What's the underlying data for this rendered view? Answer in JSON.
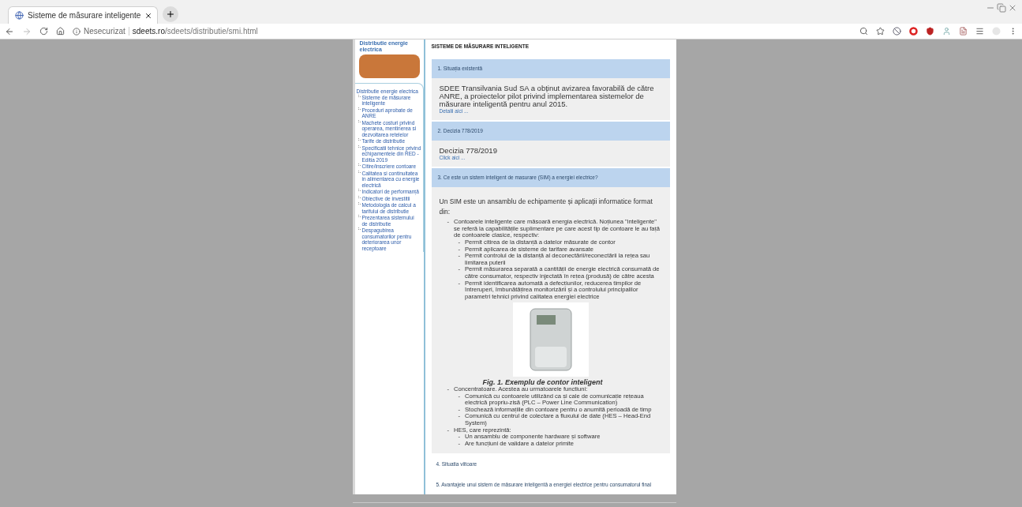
{
  "browser": {
    "tab": {
      "title": "Sisteme de măsurare inteligente",
      "selected": true
    },
    "address": {
      "security": "Nesecurizat",
      "host": "sdeets.ro",
      "path": "/sdeets/distributie/smi.html"
    }
  },
  "sidebar": {
    "header": "Distributie energie electrica",
    "tree": {
      "label": "Distributie energie electrica",
      "children": [
        {
          "label": "Sisteme de măsurare inteligente"
        },
        {
          "label": "Proceduri aprobate de ANRE"
        },
        {
          "label": "Machete costuri privind operarea, mentinerea si dezvoltarea retelelor"
        },
        {
          "label": "Tarife de distributie"
        },
        {
          "label": "Specificatii tehnice privind echipamentele din RED - Editia 2019"
        },
        {
          "label": "Citire/inscriere contoare"
        },
        {
          "label": "Calitatea si continuitatea in alimentarea cu energie electrică"
        },
        {
          "label": "Indicatori de performanță"
        },
        {
          "label": "Obiective de investitii"
        },
        {
          "label": "Metodologia de calcul a tarifului de distributie"
        },
        {
          "label": "Prezentarea sistemului de distributie"
        },
        {
          "label": "Despagubirea consumatorilor pentru deteriorarea unor receptoare"
        }
      ]
    }
  },
  "main": {
    "title": "SISTEME DE MĂSURARE INTELIGENTE",
    "sections": [
      {
        "kind": "band",
        "heading": "1. Situația existentă",
        "body": {
          "text": "SDEE Transilvania Sud SA a obținut avizarea favorabilă de către ANRE, a proiectelor pilot privind implementarea sistemelor de măsurare inteligentă pentru anul 2015.",
          "link": "Detalii aici ..."
        }
      },
      {
        "kind": "band",
        "heading": "2. Decizia 778/2019",
        "body": {
          "text": "Decizia 778/2019",
          "link": "Click aici ..."
        }
      },
      {
        "kind": "band",
        "heading": "3. Ce este un sistem inteligent de masurare (SIM) a energiei electrice?",
        "body": {
          "text": "Un SIM este un ansamblu de echipamente și aplicații informatice format din:",
          "items": [
            {
              "marker": "-",
              "text": "Contoarele inteligente care măsoară energia electrică. Noțiunea \"inteligente\" se referă la capabilitățile suplimentare pe care acest tip de contoare le au față de contoarele clasice, respectiv:",
              "children": [
                {
                  "marker": "-",
                  "text": "Permit citirea de la distanță a datelor măsurate de contor"
                },
                {
                  "marker": "-",
                  "text": "Permit aplicarea de sisteme de tarifare avansate"
                },
                {
                  "marker": "-",
                  "text": "Permit controlul de la distanță al deconectării/reconectării la rețea sau limitarea puterii"
                },
                {
                  "marker": "-",
                  "text": "Permit măsurarea separată a cantității de energie electrică consumată de către consumator, respectiv injectată în rețea (produsă) de către acesta"
                },
                {
                  "marker": "-",
                  "text": "Permit identificarea automată a defecțiunilor, reducerea timpilor de întreruperi, îmbunătățirea monitorizării și a controlului principalilor parametri tehnici privind calitatea energiei electrice"
                }
              ],
              "figure": {
                "caption": "Fig. 1. Exemplu de contor inteligent"
              }
            },
            {
              "marker": "-",
              "text": "Concentratoare. Acestea au urmatoarele functiuni:",
              "children": [
                {
                  "marker": "-",
                  "text": "Comunică cu contoarele utilizând ca și cale de comunicație rețeaua electrică propriu-zisă (PLC – Power Line Communication)"
                },
                {
                  "marker": "-",
                  "text": "Stochează informațiile din contoare pentru o anumită perioadă de timp"
                },
                {
                  "marker": "-",
                  "text": "Comunică cu centrul de colectare a fluxului de date (HES – Head-End System)"
                }
              ]
            },
            {
              "marker": "-",
              "text": "HES, care reprezintă:",
              "children": [
                {
                  "marker": "-",
                  "text": "Un ansamblu de componente hardware și software"
                },
                {
                  "marker": "-",
                  "text": "Are funcțiuni de validare a datelor primite"
                }
              ]
            }
          ]
        }
      },
      {
        "kind": "plain",
        "heading": "4. Situatia viitoare"
      },
      {
        "kind": "plain",
        "heading": "5. Avantajele unui sistem de măsurare inteligentă a energiei electrice pentru consumatorul final"
      }
    ]
  }
}
